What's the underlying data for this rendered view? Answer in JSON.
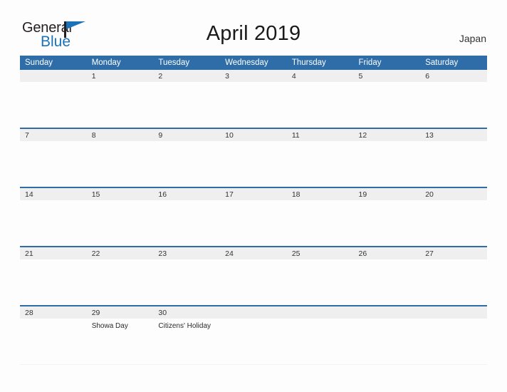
{
  "header": {
    "logo": {
      "word_one": "General",
      "word_two": "Blue",
      "flag_icon": "flag-triangle-icon",
      "brand_blue": "#1b72b8"
    },
    "title": "April 2019",
    "region": "Japan"
  },
  "calendar": {
    "month": "April",
    "year": "2019",
    "header_bg": "#2e6da8",
    "band_bg": "#efefef",
    "weekday_headers": [
      "Sunday",
      "Monday",
      "Tuesday",
      "Wednesday",
      "Thursday",
      "Friday",
      "Saturday"
    ],
    "weeks": [
      [
        {
          "day": "",
          "events": ""
        },
        {
          "day": "1",
          "events": ""
        },
        {
          "day": "2",
          "events": ""
        },
        {
          "day": "3",
          "events": ""
        },
        {
          "day": "4",
          "events": ""
        },
        {
          "day": "5",
          "events": ""
        },
        {
          "day": "6",
          "events": ""
        }
      ],
      [
        {
          "day": "7",
          "events": ""
        },
        {
          "day": "8",
          "events": ""
        },
        {
          "day": "9",
          "events": ""
        },
        {
          "day": "10",
          "events": ""
        },
        {
          "day": "11",
          "events": ""
        },
        {
          "day": "12",
          "events": ""
        },
        {
          "day": "13",
          "events": ""
        }
      ],
      [
        {
          "day": "14",
          "events": ""
        },
        {
          "day": "15",
          "events": ""
        },
        {
          "day": "16",
          "events": ""
        },
        {
          "day": "17",
          "events": ""
        },
        {
          "day": "18",
          "events": ""
        },
        {
          "day": "19",
          "events": ""
        },
        {
          "day": "20",
          "events": ""
        }
      ],
      [
        {
          "day": "21",
          "events": ""
        },
        {
          "day": "22",
          "events": ""
        },
        {
          "day": "23",
          "events": ""
        },
        {
          "day": "24",
          "events": ""
        },
        {
          "day": "25",
          "events": ""
        },
        {
          "day": "26",
          "events": ""
        },
        {
          "day": "27",
          "events": ""
        }
      ],
      [
        {
          "day": "28",
          "events": ""
        },
        {
          "day": "29",
          "events": "Showa Day"
        },
        {
          "day": "30",
          "events": "Citizens' Holiday"
        },
        {
          "day": "",
          "events": ""
        },
        {
          "day": "",
          "events": ""
        },
        {
          "day": "",
          "events": ""
        },
        {
          "day": "",
          "events": ""
        }
      ]
    ]
  }
}
